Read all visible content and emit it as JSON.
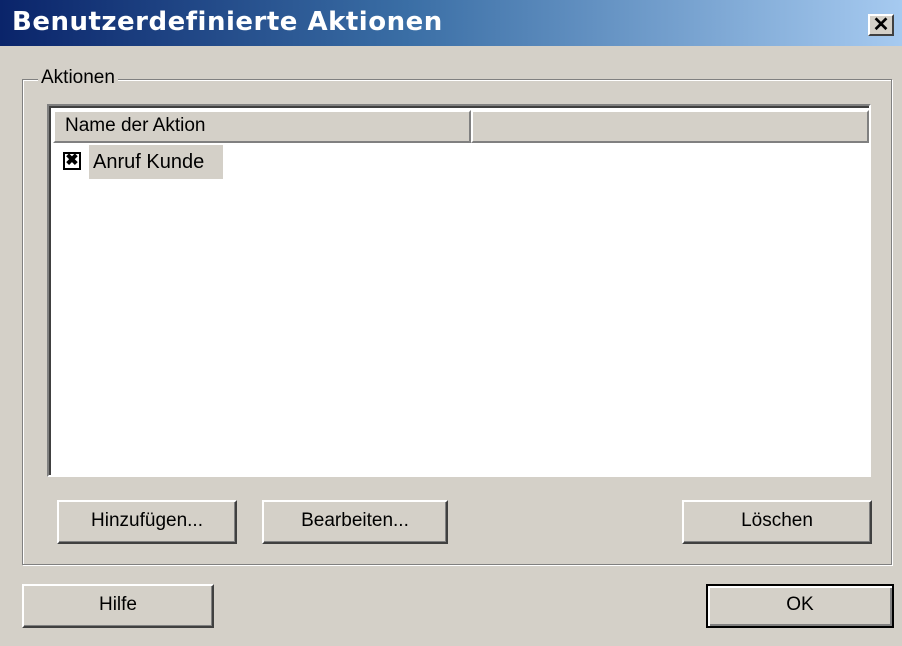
{
  "window": {
    "title": "Benutzerdefinierte Aktionen",
    "close_glyph": "✕",
    "close_icon": "close-icon"
  },
  "group": {
    "legend": "Aktionen"
  },
  "list": {
    "columns": [
      "Name der Aktion",
      ""
    ],
    "rows": [
      {
        "checked": true,
        "check_glyph": "✖",
        "label": "Anruf Kunde"
      }
    ]
  },
  "buttons": {
    "add": "Hinzufügen...",
    "edit": "Bearbeiten...",
    "delete": "Löschen",
    "help": "Hilfe",
    "ok": "OK"
  },
  "colors": {
    "face": "#d4d0c8",
    "title_start": "#0a246a",
    "title_end": "#a6caf0"
  }
}
